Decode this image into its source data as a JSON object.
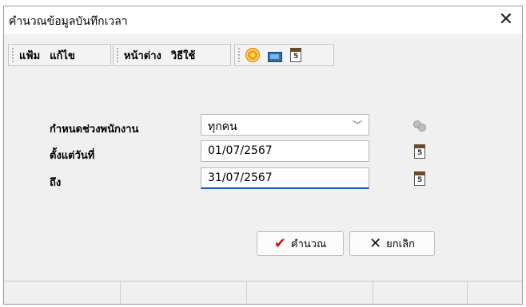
{
  "window": {
    "title": "คำนวณข้อมูลบันทึกเวลา",
    "close_glyph": "✕"
  },
  "menu": {
    "items": [
      "แฟ้ม",
      "แก้ไข",
      "หน้าต่าง",
      "วิธีใช้"
    ]
  },
  "toolbar": {
    "icons": [
      "target-icon",
      "screen-icon",
      "calendar-icon"
    ]
  },
  "form": {
    "employee_range": {
      "label": "กำหนดช่วงพนักงาน",
      "value": "ทุกคน"
    },
    "from_date": {
      "label": "ตั้งแต่วันที่",
      "value": "01/07/2567"
    },
    "to_date": {
      "label": "ถึง",
      "value": "31/07/2567"
    }
  },
  "buttons": {
    "calculate": "คำนวณ",
    "cancel": "ยกเลิก"
  },
  "colors": {
    "accent": "#1a5fb4",
    "check": "#d11818",
    "background": "#f0f0f0"
  }
}
